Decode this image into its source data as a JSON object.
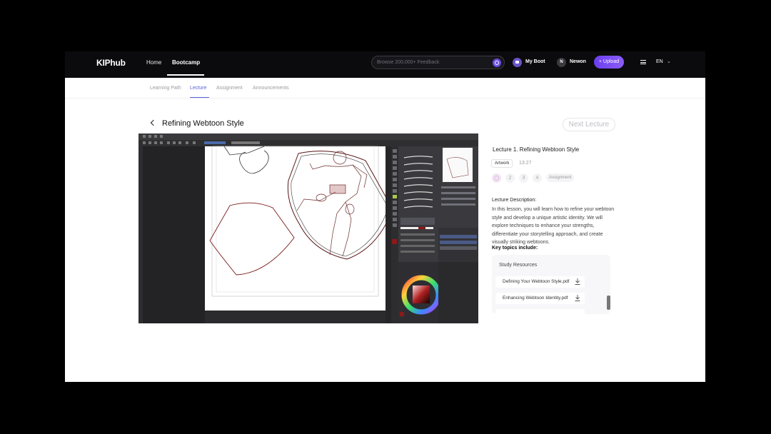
{
  "topbar": {
    "logo": "KIPhub",
    "nav": [
      "Home",
      "Bootcamp"
    ],
    "search_placeholder": "Browse 200,000+ Feedback",
    "my_boot": "My Boot",
    "user_initial": "N",
    "user_name": "Newon",
    "upload": "+ Upload",
    "lang": "EN"
  },
  "subtabs": [
    "Learning Path",
    "Lecture",
    "Assignment",
    "Announcements"
  ],
  "lecture": {
    "title": "Refining Webtoon Style",
    "next_label": "Next Lecture"
  },
  "panel": {
    "title": "Lecture 1. Refining Webtoon Style",
    "tag": "Artwork",
    "duration": "13:27",
    "steps": [
      "2",
      "3",
      "4"
    ],
    "assignment": "Assignment",
    "desc_head": "Lecture Description:",
    "desc_body": "In this lesson, you will learn how to refine your webtoon style and develop a unique artistic identity. We will explore techniques to enhance your strengths, differentiate your storytelling approach, and create visually striking webtoons.",
    "key_topics": "Key topics include:",
    "resources_title": "Study Resources",
    "resources": [
      "Defining Your Webtoon Style.pdf",
      "Enhancing Webtoon Identity.pdf"
    ]
  },
  "colors": {
    "accent": "#5a5fd8",
    "upload": "#7b4ff3",
    "topbar": "#0b0b0d"
  },
  "icons": [
    "search-icon",
    "chevron-left-icon",
    "download-icon",
    "menu-icon",
    "chevron-down-icon",
    "my-boot-icon"
  ]
}
